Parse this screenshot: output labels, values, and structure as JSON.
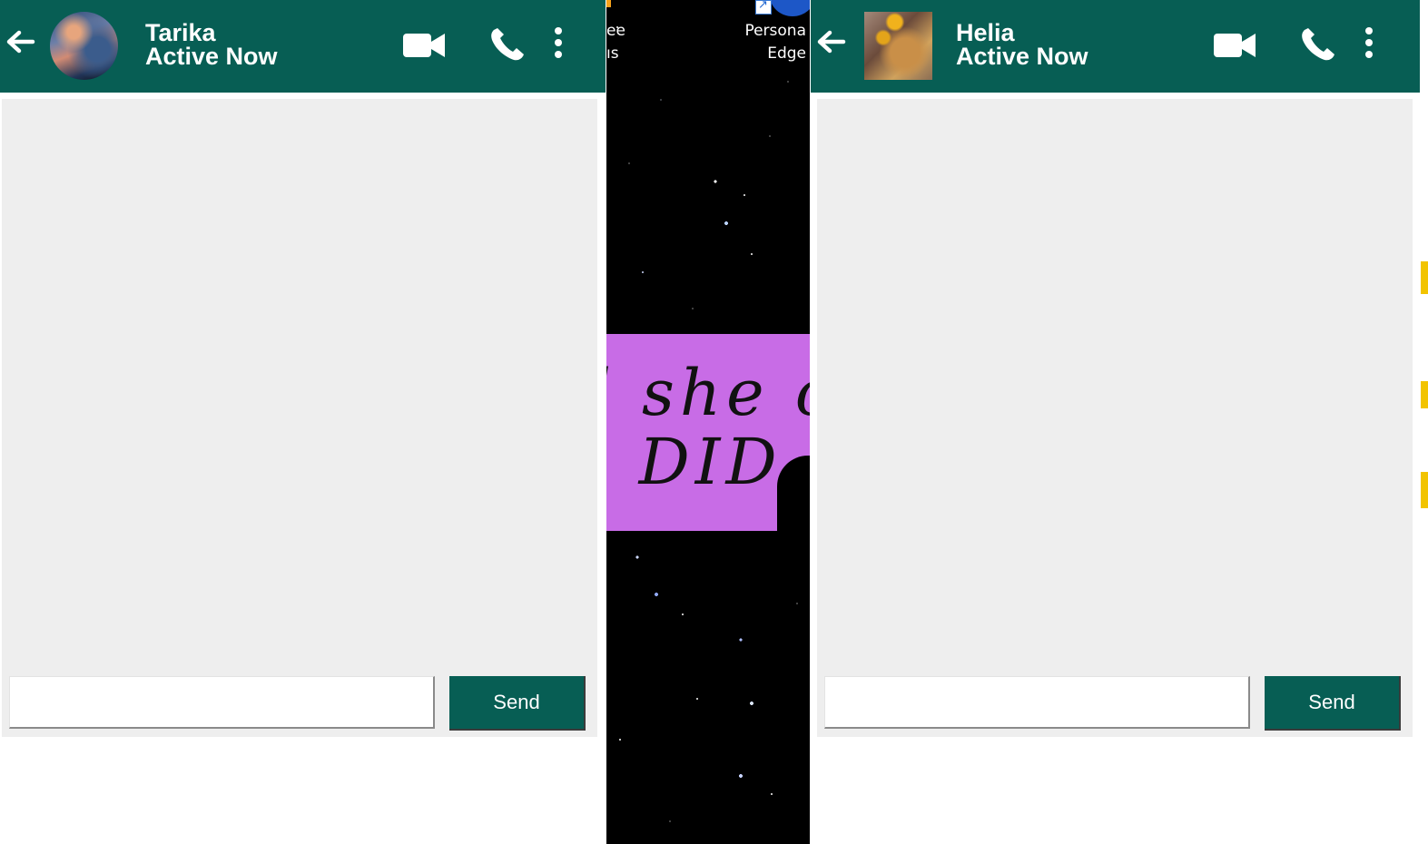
{
  "desktop": {
    "icon_left_label_line1": "ee",
    "icon_left_label_line2": "ıs",
    "icon_right_label_line1": "Persona",
    "icon_right_label_line2": "Edge",
    "wallpaper_text_line1": "d she c",
    "wallpaper_text_line2": "e DID",
    "banner_color": "#c86ce6"
  },
  "chats": [
    {
      "contact_name": "Tarika",
      "status": "Active Now",
      "avatar_shape": "circle",
      "input_value": "",
      "send_label": "Send",
      "icons": [
        "back-arrow-icon",
        "video-camera-icon",
        "phone-icon",
        "more-vertical-icon"
      ]
    },
    {
      "contact_name": "Helia",
      "status": "Active Now",
      "avatar_shape": "square",
      "input_value": "",
      "send_label": "Send",
      "icons": [
        "back-arrow-icon",
        "video-camera-icon",
        "phone-icon",
        "more-vertical-icon"
      ]
    }
  ],
  "colors": {
    "header": "#075e54",
    "message_area": "#eeeeee",
    "send_button": "#075e54"
  }
}
